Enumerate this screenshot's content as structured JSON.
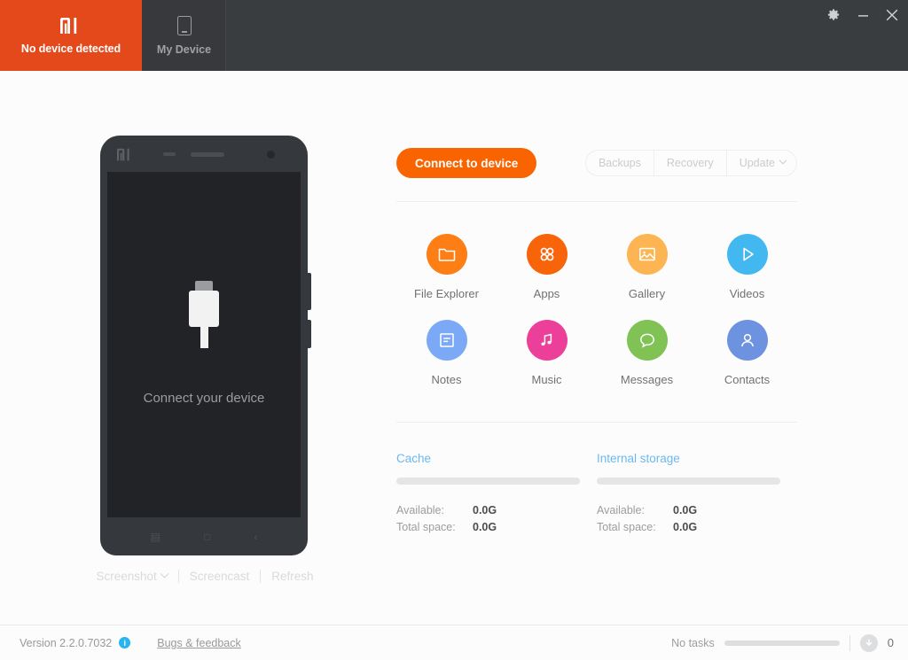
{
  "window": {
    "tabs": [
      {
        "label": "No device detected",
        "icon": "mi-logo-icon",
        "active": true
      },
      {
        "label": "My Device",
        "icon": "device-tablet-icon",
        "active": false
      }
    ],
    "controls": [
      {
        "name": "settings-gear-button",
        "glyph": "⚙"
      },
      {
        "name": "minimize-button",
        "glyph": "–"
      },
      {
        "name": "close-button",
        "glyph": "✕"
      }
    ]
  },
  "phone_preview": {
    "caption": "Connect your device",
    "nav_glyphs": [
      "▤",
      "□",
      "‹"
    ],
    "actions": [
      {
        "label": "Screenshot",
        "has_caret": true
      },
      {
        "label": "Screencast",
        "has_caret": false
      },
      {
        "label": "Refresh",
        "has_caret": false
      }
    ]
  },
  "toolbar": {
    "connect_label": "Connect to device",
    "segments": [
      {
        "label": "Backups",
        "has_caret": false
      },
      {
        "label": "Recovery",
        "has_caret": false
      },
      {
        "label": "Update",
        "has_caret": true
      }
    ]
  },
  "shortcuts": [
    {
      "label": "File Explorer",
      "icon": "folder-icon",
      "color": "#fd7e14"
    },
    {
      "label": "Apps",
      "icon": "apps-grid-icon",
      "color": "#f8640a"
    },
    {
      "label": "Gallery",
      "icon": "image-icon",
      "color": "#fcb552"
    },
    {
      "label": "Videos",
      "icon": "play-icon",
      "color": "#43b8f0"
    },
    {
      "label": "Notes",
      "icon": "note-icon",
      "color": "#7ca9f5"
    },
    {
      "label": "Music",
      "icon": "music-icon",
      "color": "#ec3f9a"
    },
    {
      "label": "Messages",
      "icon": "chat-icon",
      "color": "#80c254"
    },
    {
      "label": "Contacts",
      "icon": "person-icon",
      "color": "#6d92e0"
    }
  ],
  "storage": [
    {
      "title": "Cache",
      "fill_percent": 0,
      "rows": [
        {
          "key": "Available:",
          "value": "0.0G"
        },
        {
          "key": "Total space:",
          "value": "0.0G"
        }
      ]
    },
    {
      "title": "Internal storage",
      "fill_percent": 0,
      "rows": [
        {
          "key": "Available:",
          "value": "0.0G"
        },
        {
          "key": "Total space:",
          "value": "0.0G"
        }
      ]
    }
  ],
  "statusbar": {
    "version": "Version 2.2.0.7032",
    "info_glyph": "i",
    "feedback": "Bugs & feedback",
    "tasks": "No tasks",
    "task_progress": 0,
    "download_count": "0"
  },
  "colors": {
    "brand_orange": "#e4491c",
    "accent_orange": "#fa6400",
    "titlebar": "#3a3d40",
    "link_blue": "#6bb8f0"
  }
}
